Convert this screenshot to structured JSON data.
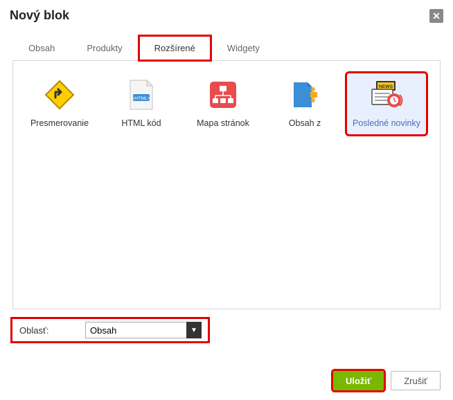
{
  "dialog": {
    "title": "Nový blok",
    "close_label": "✕"
  },
  "tabs": {
    "obsah": "Obsah",
    "produkty": "Produkty",
    "rozsirene": "Rozšírené",
    "widgety": "Widgety",
    "active": "rozsirene"
  },
  "blocks": {
    "presmerovanie": "Presmerovanie",
    "html_kod": "HTML kód",
    "mapa_stranok": "Mapa stránok",
    "obsah_z": "Obsah z",
    "posledne_novinky": "Posledné novinky"
  },
  "footer": {
    "oblast_label": "Oblasť:",
    "oblast_value": "Obsah"
  },
  "actions": {
    "save": "Uložiť",
    "cancel": "Zrušiť"
  },
  "highlights": {
    "tab": "rozsirene",
    "block": "posledne_novinky",
    "oblast_row": true,
    "save_button": true
  }
}
